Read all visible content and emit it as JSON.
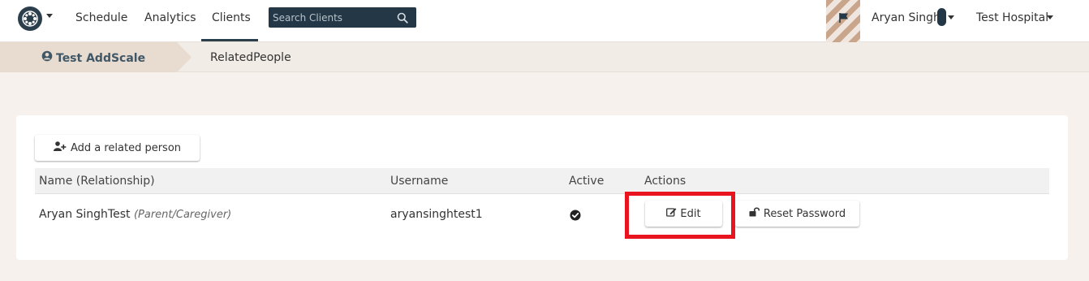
{
  "nav": {
    "logo_icon": "compass-star-icon",
    "links": [
      {
        "label": "Schedule"
      },
      {
        "label": "Analytics"
      },
      {
        "label": "Clients"
      }
    ],
    "active_link": "Clients",
    "search_placeholder": "Search Clients",
    "flag_icon": "flag-icon",
    "user_name": "Aryan Singh",
    "organization": "Test Hospital"
  },
  "breadcrumb": {
    "client_name": "Test AddScale",
    "current_page": "RelatedPeople"
  },
  "related_people": {
    "add_button_label": "Add a related person",
    "columns": [
      "Name (Relationship)",
      "Username",
      "Active",
      "Actions"
    ],
    "rows": [
      {
        "name": "Aryan SinghTest",
        "relationship": "(Parent/Caregiver)",
        "username": "aryansinghtest1",
        "active": true,
        "actions": [
          "Edit",
          "Reset Password"
        ]
      }
    ]
  },
  "colors": {
    "nav_dark": "#233746",
    "page_bg": "#f6f1ec",
    "highlight": "#e8141f"
  }
}
